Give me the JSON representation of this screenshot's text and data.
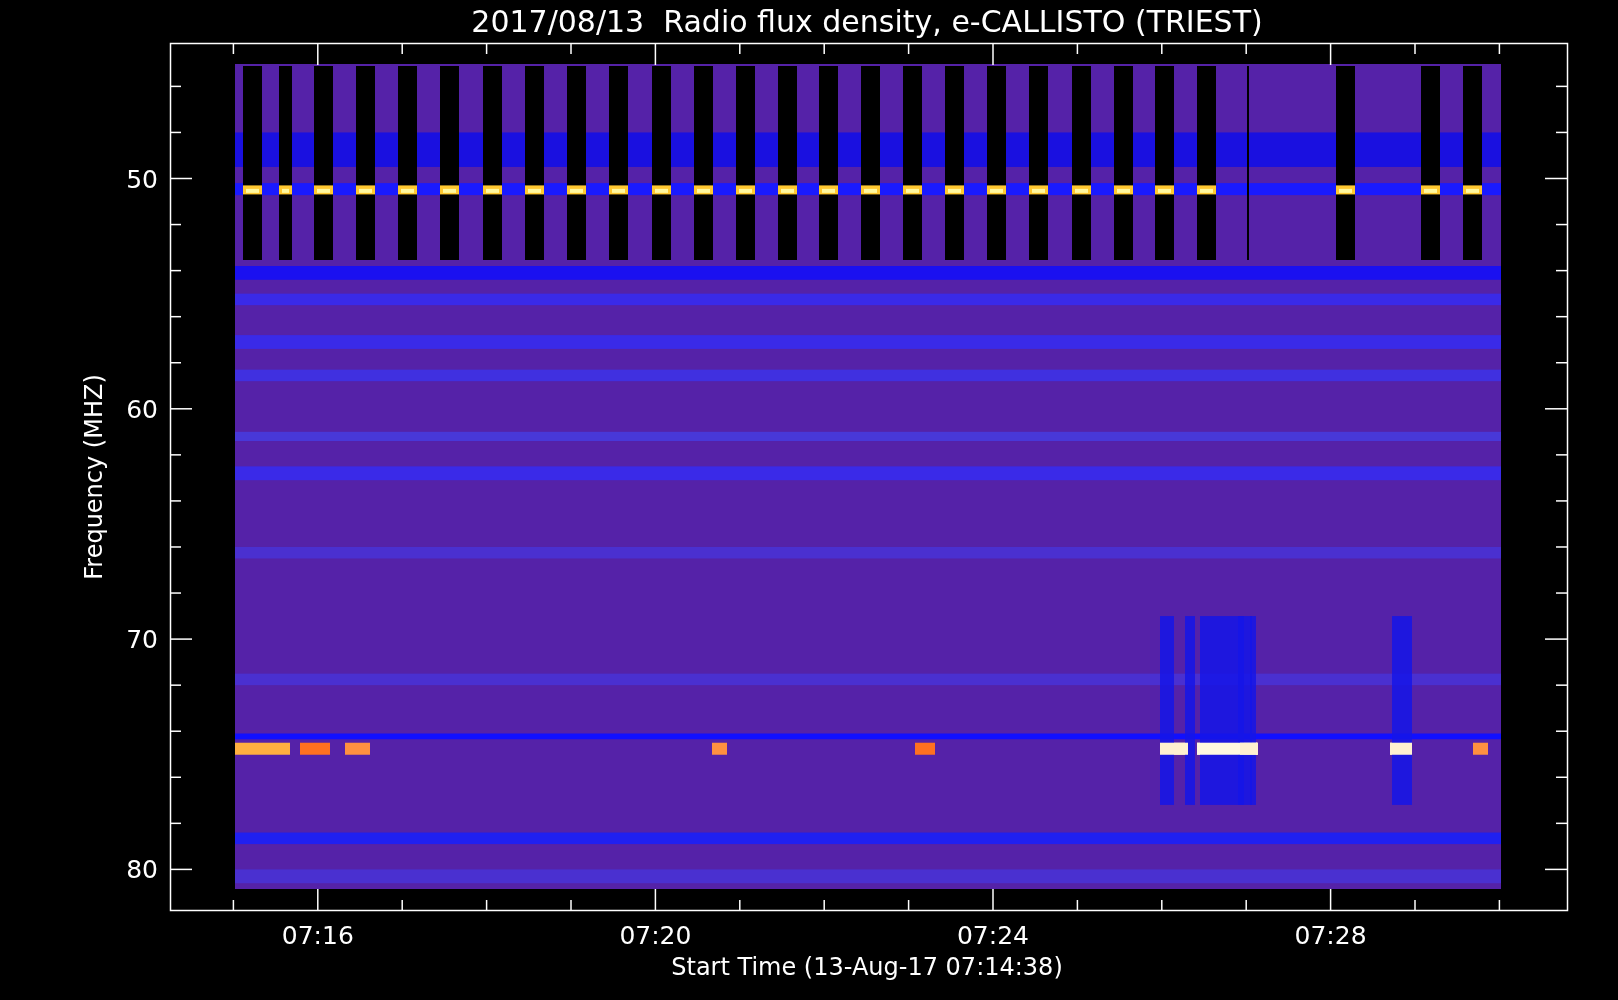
{
  "title": "2017/08/13  Radio flux density, e-CALLISTO (TRIEST)",
  "y_axis": {
    "label": "Frequency (MHZ)",
    "tick_labels": [
      "50",
      "60",
      "70",
      "80"
    ]
  },
  "x_axis": {
    "label": "Start Time (13-Aug-17 07:14:38)",
    "tick_labels": [
      "07:16",
      "07:20",
      "07:24",
      "07:28"
    ]
  }
}
